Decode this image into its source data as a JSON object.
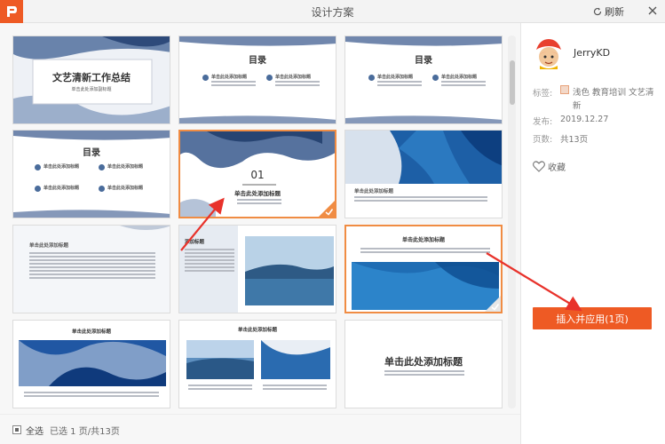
{
  "window": {
    "title": "设计方案",
    "refresh_label": "刷新"
  },
  "slides": [
    {
      "title": "文艺清新工作总结",
      "subtitle": "单击此处添加副标题"
    },
    {
      "title": "目录",
      "item1": "单击此处添加标题",
      "item2": "单击此处添加标题"
    },
    {
      "title": "目录",
      "item1": "单击此处添加标题",
      "item2": "单击此处添加标题"
    },
    {
      "title": "目录",
      "item1": "单击此处添加标题",
      "item2": "单击此处添加标题",
      "item3": "单击此处添加标题",
      "item4": "单击此处添加标题"
    },
    {
      "number": "01",
      "title": "单击此处添加标题"
    },
    {
      "title": "单击此处添加标题"
    },
    {
      "title": "单击此处添加标题"
    },
    {
      "title": "添加标题"
    },
    {
      "title": "单击此处添加标题"
    },
    {
      "title": "单击此处添加标题"
    },
    {
      "title": "单击此处添加标题"
    },
    {
      "title": "单击此处添加标题"
    }
  ],
  "footer": {
    "select_all": "全选",
    "selection_info": "已选 1 页/共13页"
  },
  "info": {
    "author": "JerryKD",
    "tags_label": "标签:",
    "tags_value": "浅色 教育培训 文艺清新",
    "published_label": "发布:",
    "published_value": "2019.12.27",
    "pages_label": "页数:",
    "pages_value": "共13页",
    "favorite_label": "收藏",
    "apply_button": "插入并应用(1页)"
  },
  "colors": {
    "accent": "#ee5a24",
    "selected_border": "#f08c43",
    "ink_blue": "#2c4f86"
  },
  "icons": [
    "app-logo-icon",
    "refresh-icon",
    "close-icon",
    "heart-icon",
    "tag-icon",
    "checkmark-icon"
  ]
}
